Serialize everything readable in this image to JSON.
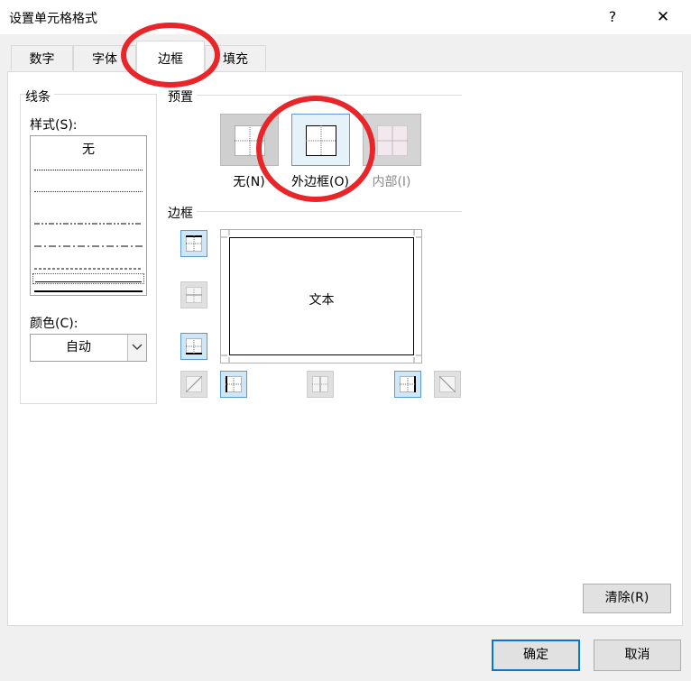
{
  "dialog": {
    "title": "设置单元格格式",
    "help": "?",
    "close": "✕"
  },
  "tabs": [
    {
      "label": "数字"
    },
    {
      "label": "字体"
    },
    {
      "label": "边框"
    },
    {
      "label": "填充"
    }
  ],
  "line_group": {
    "title": "线条",
    "style_label": "样式(S):",
    "style_none": "无",
    "color_label": "颜色(C):",
    "color_value": "自动"
  },
  "presets": {
    "title": "预置",
    "items": [
      {
        "label": "无(N)"
      },
      {
        "label": "外边框(O)"
      },
      {
        "label": "内部(I)"
      }
    ]
  },
  "border": {
    "title": "边框",
    "preview_text": "文本"
  },
  "buttons": {
    "clear": "清除(R)",
    "ok": "确定",
    "cancel": "取消"
  },
  "annotations": {
    "circle_color": "#e8262a"
  },
  "colors": {
    "accent": "#0078d7",
    "selected_bg": "#cfe6f7",
    "selected_border": "#5a9bd5"
  }
}
